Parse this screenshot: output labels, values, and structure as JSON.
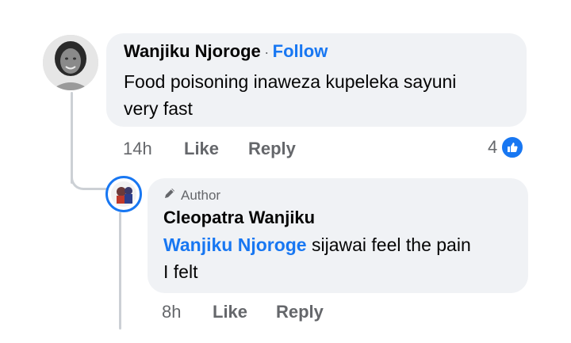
{
  "comment": {
    "author": "Wanjiku Njoroge",
    "separator": "·",
    "follow_label": "Follow",
    "text_line1": "Food poisoning inaweza kupeleka sayuni",
    "text_line2": "very fast",
    "time": "14h",
    "like_label": "Like",
    "reply_label": "Reply",
    "reaction_count": "4",
    "reaction_icon": "thumbs-up-icon",
    "accent_color": "#1877f2"
  },
  "reply": {
    "badge_icon": "pencil-icon",
    "badge_label": "Author",
    "author": "Cleopatra Wanjiku",
    "mention": "Wanjiku Njoroge",
    "text_line1_rest": " sijawai feel the pain",
    "text_line2": "I felt",
    "time": "8h",
    "like_label": "Like",
    "reply_label": "Reply"
  }
}
